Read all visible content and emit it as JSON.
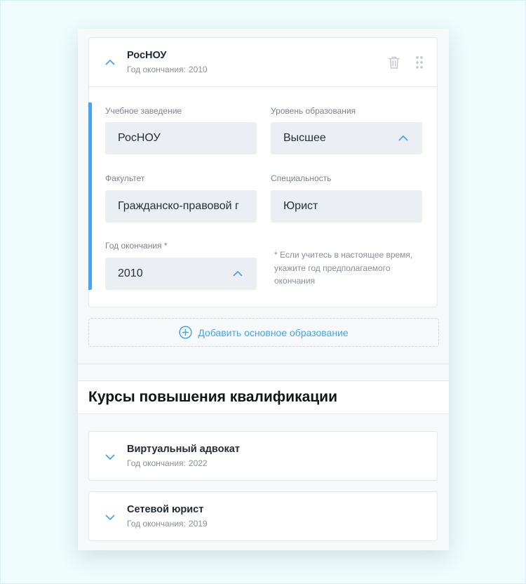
{
  "education": {
    "title": "РосНОУ",
    "sub_label": "Год окончания:",
    "sub_year": "2010",
    "fields": {
      "institution_label": "Учебное заведение",
      "institution_value": "РосНОУ",
      "level_label": "Уровень образования",
      "level_value": "Высшее",
      "faculty_label": "Факультет",
      "faculty_value": "Гражданско-правовой г",
      "specialty_label": "Специальность",
      "specialty_value": "Юрист",
      "year_label": "Год окончания *",
      "year_value": "2010"
    },
    "hint": "* Если учитесь в настоящее время, укажите год предполагаемого окончания",
    "add_button": "Добавить основное образование"
  },
  "courses": {
    "title": "Курсы повышения квалификации",
    "items": [
      {
        "title": "Виртуальный адвокат",
        "sub_label": "Год окончания:",
        "sub_year": "2022"
      },
      {
        "title": "Сетевой юрист",
        "sub_label": "Год окончания:",
        "sub_year": "2019"
      }
    ]
  },
  "colors": {
    "accent": "#4aa3ef",
    "field_bg": "#ebeef2",
    "page_bg": "#effcfc"
  }
}
